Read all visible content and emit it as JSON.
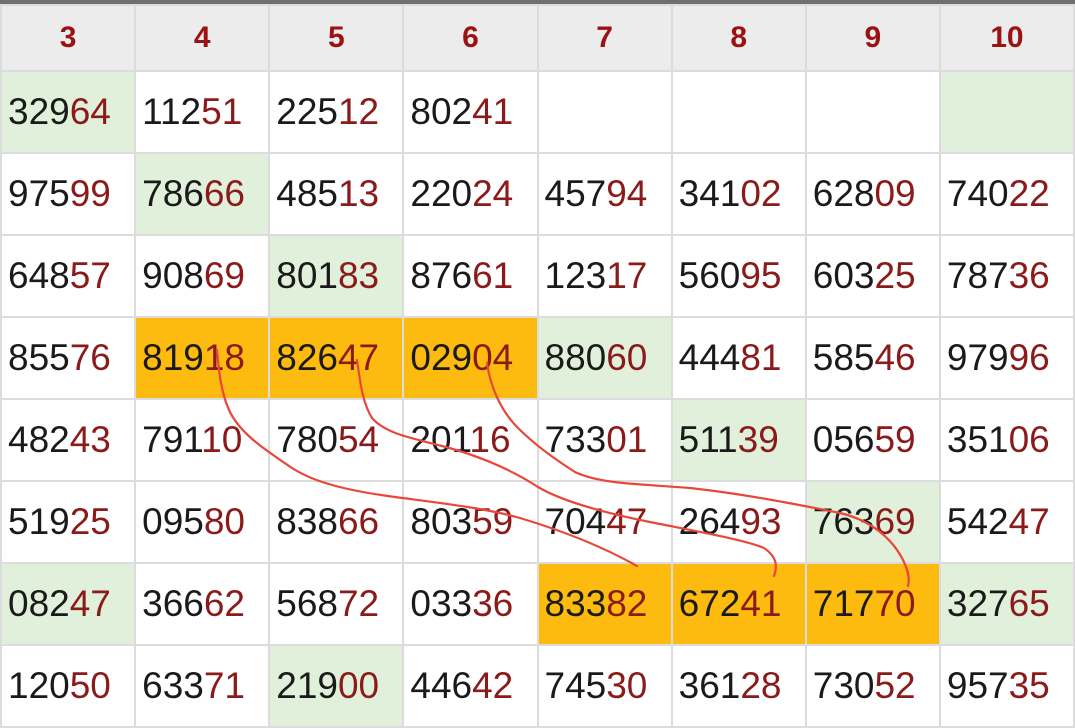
{
  "headers": [
    "3",
    "4",
    "5",
    "6",
    "7",
    "8",
    "9",
    "10"
  ],
  "rows": [
    [
      {
        "head": "329",
        "tail": "64",
        "bg": "green"
      },
      {
        "head": "112",
        "tail": "51",
        "bg": "white"
      },
      {
        "head": "225",
        "tail": "12",
        "bg": "white"
      },
      {
        "head": "802",
        "tail": "41",
        "bg": "white"
      },
      {
        "head": "",
        "tail": "",
        "bg": "white"
      },
      {
        "head": "",
        "tail": "",
        "bg": "white"
      },
      {
        "head": "",
        "tail": "",
        "bg": "white"
      },
      {
        "head": "",
        "tail": "",
        "bg": "green"
      }
    ],
    [
      {
        "head": "975",
        "tail": "99",
        "bg": "white"
      },
      {
        "head": "786",
        "tail": "66",
        "bg": "green"
      },
      {
        "head": "485",
        "tail": "13",
        "bg": "white"
      },
      {
        "head": "220",
        "tail": "24",
        "bg": "white"
      },
      {
        "head": "457",
        "tail": "94",
        "bg": "white"
      },
      {
        "head": "341",
        "tail": "02",
        "bg": "white"
      },
      {
        "head": "628",
        "tail": "09",
        "bg": "white"
      },
      {
        "head": "740",
        "tail": "22",
        "bg": "white"
      }
    ],
    [
      {
        "head": "648",
        "tail": "57",
        "bg": "white"
      },
      {
        "head": "908",
        "tail": "69",
        "bg": "white"
      },
      {
        "head": "801",
        "tail": "83",
        "bg": "green"
      },
      {
        "head": "876",
        "tail": "61",
        "bg": "white"
      },
      {
        "head": "123",
        "tail": "17",
        "bg": "white"
      },
      {
        "head": "560",
        "tail": "95",
        "bg": "white"
      },
      {
        "head": "603",
        "tail": "25",
        "bg": "white"
      },
      {
        "head": "787",
        "tail": "36",
        "bg": "white"
      }
    ],
    [
      {
        "head": "855",
        "tail": "76",
        "bg": "white"
      },
      {
        "head": "819",
        "tail": "18",
        "bg": "orange"
      },
      {
        "head": "826",
        "tail": "47",
        "bg": "orange"
      },
      {
        "head": "029",
        "tail": "04",
        "bg": "orange"
      },
      {
        "head": "880",
        "tail": "60",
        "bg": "green"
      },
      {
        "head": "444",
        "tail": "81",
        "bg": "white"
      },
      {
        "head": "585",
        "tail": "46",
        "bg": "white"
      },
      {
        "head": "979",
        "tail": "96",
        "bg": "white"
      }
    ],
    [
      {
        "head": "482",
        "tail": "43",
        "bg": "white"
      },
      {
        "head": "791",
        "tail": "10",
        "bg": "white"
      },
      {
        "head": "780",
        "tail": "54",
        "bg": "white"
      },
      {
        "head": "201",
        "tail": "16",
        "bg": "white"
      },
      {
        "head": "733",
        "tail": "01",
        "bg": "white"
      },
      {
        "head": "511",
        "tail": "39",
        "bg": "green"
      },
      {
        "head": "056",
        "tail": "59",
        "bg": "white"
      },
      {
        "head": "351",
        "tail": "06",
        "bg": "white"
      }
    ],
    [
      {
        "head": "519",
        "tail": "25",
        "bg": "white"
      },
      {
        "head": "095",
        "tail": "80",
        "bg": "white"
      },
      {
        "head": "838",
        "tail": "66",
        "bg": "white"
      },
      {
        "head": "803",
        "tail": "59",
        "bg": "white"
      },
      {
        "head": "704",
        "tail": "47",
        "bg": "white"
      },
      {
        "head": "264",
        "tail": "93",
        "bg": "white"
      },
      {
        "head": "763",
        "tail": "69",
        "bg": "green"
      },
      {
        "head": "542",
        "tail": "47",
        "bg": "white"
      }
    ],
    [
      {
        "head": "082",
        "tail": "47",
        "bg": "green"
      },
      {
        "head": "366",
        "tail": "62",
        "bg": "white"
      },
      {
        "head": "568",
        "tail": "72",
        "bg": "white"
      },
      {
        "head": "033",
        "tail": "36",
        "bg": "white"
      },
      {
        "head": "833",
        "tail": "82",
        "bg": "orange"
      },
      {
        "head": "672",
        "tail": "41",
        "bg": "orange"
      },
      {
        "head": "717",
        "tail": "70",
        "bg": "orange"
      },
      {
        "head": "327",
        "tail": "65",
        "bg": "green"
      }
    ],
    [
      {
        "head": "120",
        "tail": "50",
        "bg": "white"
      },
      {
        "head": "633",
        "tail": "71",
        "bg": "white"
      },
      {
        "head": "219",
        "tail": "00",
        "bg": "green"
      },
      {
        "head": "446",
        "tail": "42",
        "bg": "white"
      },
      {
        "head": "745",
        "tail": "30",
        "bg": "white"
      },
      {
        "head": "361",
        "tail": "28",
        "bg": "white"
      },
      {
        "head": "730",
        "tail": "52",
        "bg": "white"
      },
      {
        "head": "957",
        "tail": "35",
        "bg": "white"
      }
    ]
  ],
  "colors": {
    "header_text": "#9a1212",
    "tail_text": "#8b1a1a",
    "highlight_orange": "#fdbb10",
    "highlight_green": "#e1f0da",
    "annotation_line": "#e8473a"
  }
}
